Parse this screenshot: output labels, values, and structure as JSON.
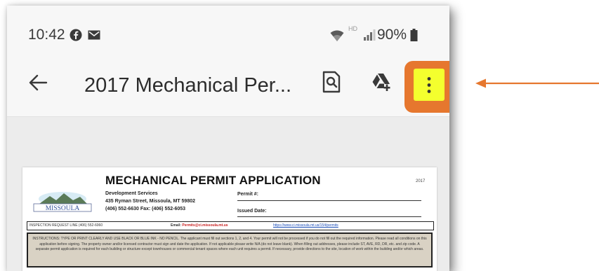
{
  "status_bar": {
    "time": "10:42",
    "network": "HD",
    "battery": "90%"
  },
  "app_bar": {
    "title": "2017 Mechanical Per...",
    "highlight_colors": {
      "border": "#e6772e",
      "fill": "#f4ff2e"
    }
  },
  "document": {
    "title": "MECHANICAL PERMIT APPLICATION",
    "year": "2017",
    "logo_text": "MISSOULA",
    "address_lines": [
      "Development Services",
      "435 Ryman Street, Missoula, MT 59802",
      "(406) 552-6630  Fax: (406) 552-6053"
    ],
    "permit_label": "Permit #:",
    "issued_label": "Issued Date:",
    "inspection_label": "INSPECTION REQUEST LINE (406) 552-6060",
    "email_label": "Email:",
    "email_value": "Permits@ci.missoula.mt.us",
    "link": "https://www.ci.missoula.mt.us/154/permits",
    "instructions": "INSTRUCTIONS: TYPE OR PRINT CLEARLY AND USE BLACK OR BLUE INK - NO PENCIL. The applicant must fill out sections 1, 2, and 4. Your permit will not be processed if you do not fill out the required information. Please read all conditions on this application before signing. The property owner and/or licensed contractor must sign and date the application. If not applicable please write N/A (do not leave blank). When filling out addresses, please include ST, AVE, RD, DR, etc. and zip code. A separate permit application is required for each building or structure except townhouses or commercial tenant spaces where each unit requires a permit. If necessary, provide directions to the site, location of work within the building and/or which areas."
  },
  "annotation": {
    "arrow_color": "#e6772e"
  }
}
